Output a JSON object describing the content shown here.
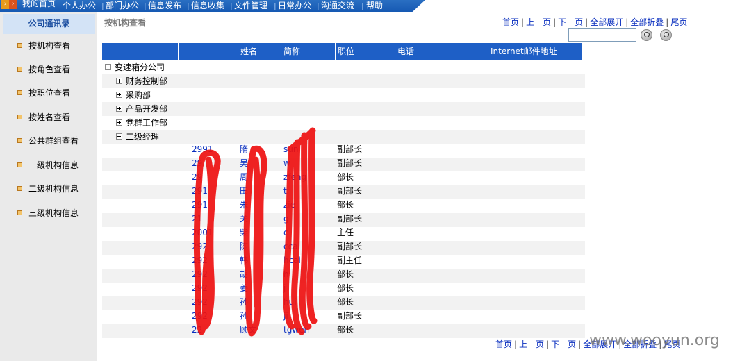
{
  "topnav": {
    "items": [
      "我的首页",
      "个人办公",
      "部门办公",
      "信息发布",
      "信息收集",
      "文件管理",
      "日常办公",
      "沟通交流",
      "帮助"
    ]
  },
  "sidebar": {
    "title": "公司通讯录",
    "items": [
      "按机构查看",
      "按角色查看",
      "按职位查看",
      "按姓名查看",
      "公共群组查看",
      "一级机构信息",
      "二级机构信息",
      "三级机构信息"
    ]
  },
  "page_title": "按机构查看",
  "pager": {
    "first": "首页",
    "prev": "上一页",
    "next": "下一页",
    "expand_all": "全部展开",
    "collapse_all": "全部折叠",
    "last": "尾页",
    "bottom_expand_all": "全部展开",
    "bottom_collapse_all": "全部折叠",
    "bottom_last": "尾页"
  },
  "search": {
    "value": ""
  },
  "table": {
    "headers": [
      "",
      "",
      "姓名",
      "简称",
      "职位",
      "电话",
      "Internet邮件地址"
    ],
    "tree": {
      "root": "变速箱分公司",
      "departments": [
        "财务控制部",
        "采购部",
        "产品开发部",
        "党群工作部",
        "二级经理"
      ]
    },
    "rows": [
      {
        "id": "2991",
        "name": "隋",
        "abbr": "sun",
        "position": "副部长"
      },
      {
        "id": "29",
        "name": "吴",
        "abbr": "w",
        "position": "副部长"
      },
      {
        "id": "29",
        "name": "周",
        "abbr": "zfeng",
        "position": "部长"
      },
      {
        "id": "291",
        "name": "田",
        "abbr": "ti",
        "position": "副部长"
      },
      {
        "id": "291",
        "name": "朱",
        "abbr": "zie",
        "position": "部长"
      },
      {
        "id": "21",
        "name": "关",
        "abbr": "g",
        "position": "副部长"
      },
      {
        "id": "2001",
        "name": "柴",
        "abbr": "c",
        "position": "主任"
      },
      {
        "id": "292",
        "name": "陈",
        "abbr": "ccai",
        "position": "副部长"
      },
      {
        "id": "292",
        "name": "韩",
        "abbr": "hcai",
        "position": "副主任"
      },
      {
        "id": "292",
        "name": "胡",
        "abbr": "h",
        "position": "部长"
      },
      {
        "id": "292",
        "name": "姜",
        "abbr": "j",
        "position": "部长"
      },
      {
        "id": "292",
        "name": "孙",
        "abbr": "hui",
        "position": "部长"
      },
      {
        "id": "292",
        "name": "孙",
        "abbr": "ji",
        "position": "副部长"
      },
      {
        "id": "22",
        "name": "顾文",
        "abbr": "tgwen",
        "position": "部长"
      }
    ]
  },
  "watermark": "www.wooyun.org",
  "colors": {
    "accent": "#1e5fc6",
    "link": "#0a2fbf",
    "redaction": "#ee1111"
  }
}
